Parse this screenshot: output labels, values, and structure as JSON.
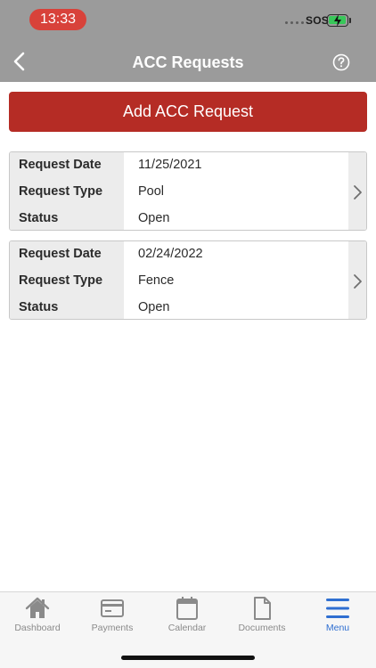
{
  "status_bar": {
    "time": "13:33",
    "carrier": "SOS"
  },
  "header": {
    "title": "ACC Requests"
  },
  "actions": {
    "add_label": "Add ACC Request"
  },
  "requests": [
    {
      "date_label": "Request Date",
      "date": "11/25/2021",
      "type_label": "Request Type",
      "type": "Pool",
      "status_label": "Status",
      "status": "Open"
    },
    {
      "date_label": "Request Date",
      "date": "02/24/2022",
      "type_label": "Request Type",
      "type": "Fence",
      "status_label": "Status",
      "status": "Open"
    }
  ],
  "tabs": [
    {
      "label": "Dashboard",
      "icon": "home-icon",
      "active": false
    },
    {
      "label": "Payments",
      "icon": "credit-card-icon",
      "active": false
    },
    {
      "label": "Calendar",
      "icon": "calendar-icon",
      "active": false
    },
    {
      "label": "Documents",
      "icon": "document-icon",
      "active": false
    },
    {
      "label": "Menu",
      "icon": "menu-icon",
      "active": true
    }
  ],
  "colors": {
    "header_bg": "#9b9b9b",
    "primary_button": "#b52c25",
    "active_tab": "#2f6fd1",
    "time_pill": "#d8423a"
  }
}
